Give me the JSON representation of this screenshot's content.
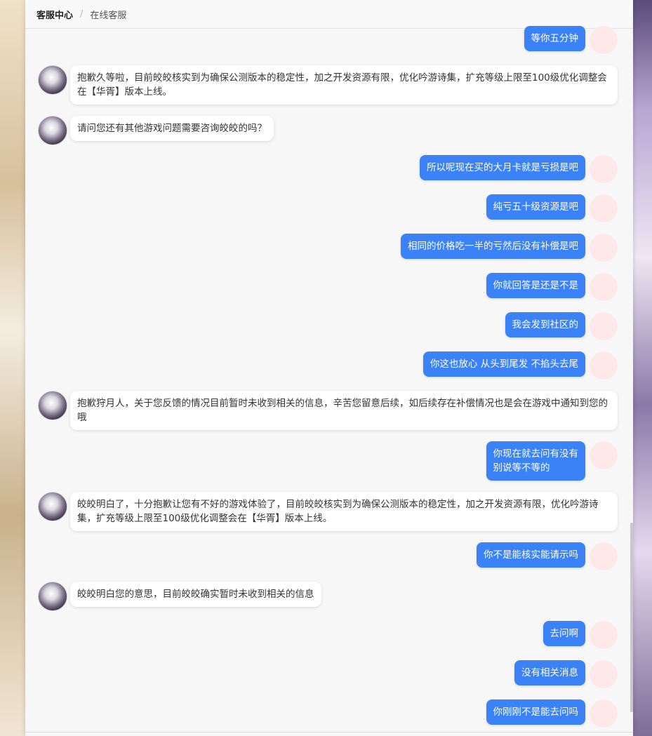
{
  "breadcrumb": {
    "home": "客服中心",
    "separator": "/",
    "current": "在线客服"
  },
  "messages": [
    {
      "side": "user",
      "text": "等你五分钟"
    },
    {
      "side": "agent",
      "text": "抱歉久等啦，目前皎皎核实到为确保公测版本的稳定性，加之开发资源有限，优化吟游诗集，扩充等级上限至100级优化调整会在【华胥】版本上线。"
    },
    {
      "side": "agent",
      "text": "请问您还有其他游戏问题需要咨询皎皎的吗？"
    },
    {
      "side": "user",
      "text": "所以呢现在买的大月卡就是亏损是吧"
    },
    {
      "side": "user",
      "text": "纯亏五十级资源是吧"
    },
    {
      "side": "user",
      "text": "相同的价格吃一半的亏然后没有补偿是吧"
    },
    {
      "side": "user",
      "text": "你就回答是还是不是"
    },
    {
      "side": "user",
      "text": "我会发到社区的"
    },
    {
      "side": "user",
      "text": "你这也放心 从头到尾发 不掐头去尾"
    },
    {
      "side": "agent",
      "text": "抱歉狩月人，关于您反馈的情况目前暂时未收到相关的信息，辛苦您留意后续，如后续存在补偿情况也是会在游戏中通知到您的哦"
    },
    {
      "side": "user",
      "text": "你现在就去问有没有\n别说等不等的"
    },
    {
      "side": "agent",
      "text": "皎皎明白了，十分抱歉让您有不好的游戏体验了，目前皎皎核实到为确保公测版本的稳定性，加之开发资源有限，优化吟游诗集，扩充等级上限至100级优化调整会在【华胥】版本上线。"
    },
    {
      "side": "user",
      "text": "你不是能核实能请示吗"
    },
    {
      "side": "agent",
      "text": "皎皎明白您的意思，目前皎皎确实暂时未收到相关的信息"
    },
    {
      "side": "user",
      "text": "去问啊"
    },
    {
      "side": "user",
      "text": "没有相关消息"
    },
    {
      "side": "user",
      "text": "你刚刚不是能去问吗"
    }
  ]
}
